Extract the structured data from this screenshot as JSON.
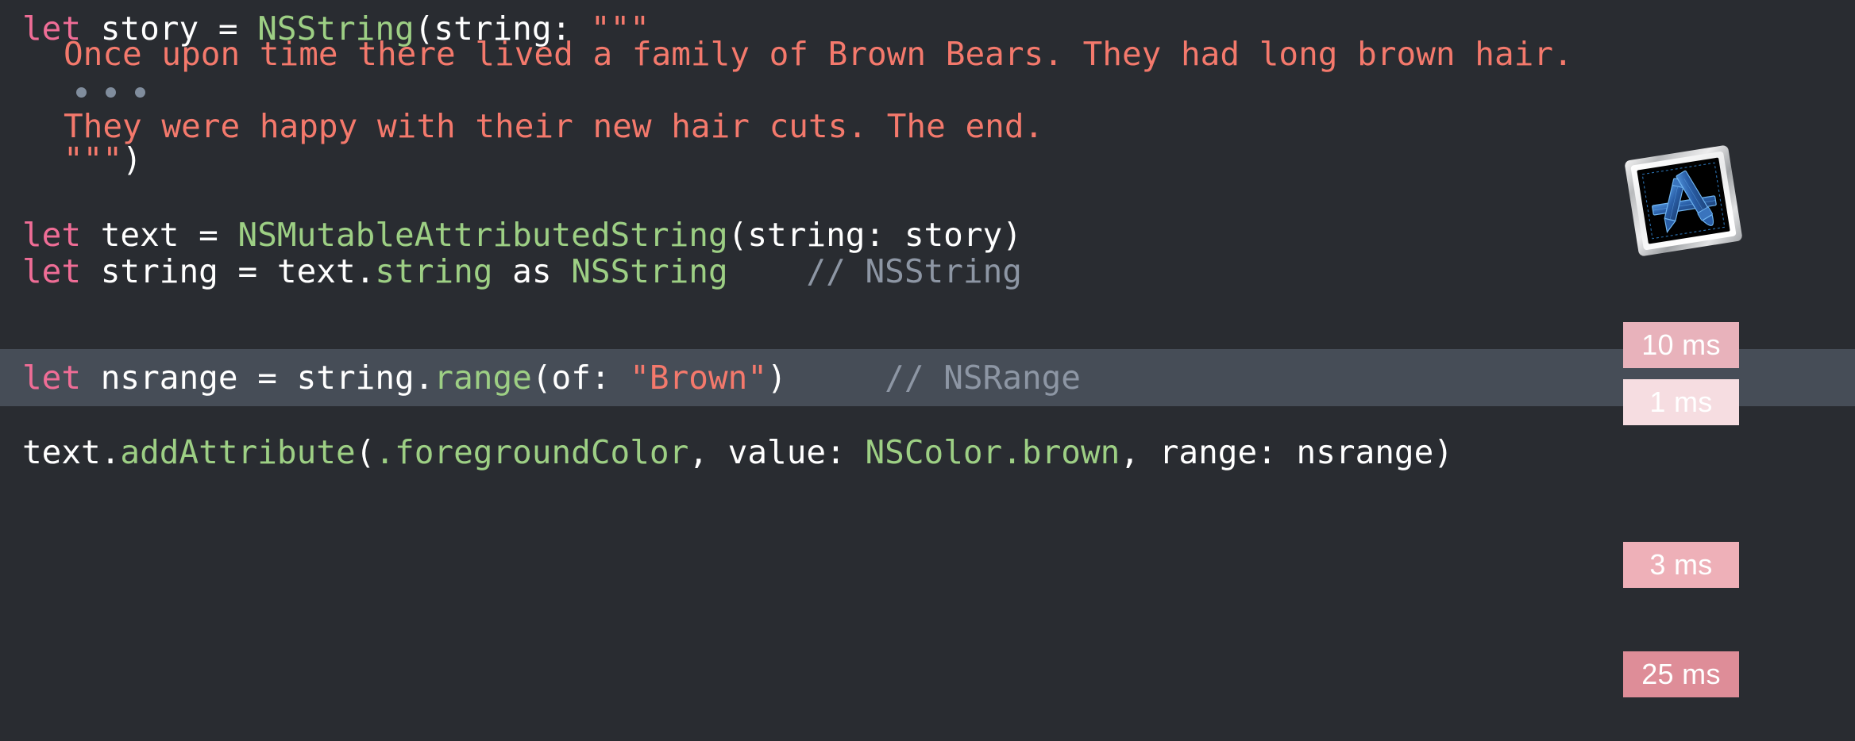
{
  "editor": {
    "background_color": "#292c31",
    "highlight_color": "#464d57",
    "colors": {
      "keyword": "#ef6d96",
      "plain": "#ffffff",
      "type": "#9dcf84",
      "string": "#f4796c",
      "comment": "#8d96a4",
      "fold_dot": "#808d9d"
    }
  },
  "code": {
    "line1": {
      "kw_let": "let",
      "name": " story ",
      "eq": "= ",
      "type": "NSString",
      "paren": "(",
      "label": "string: ",
      "quotes": "\"\"\""
    },
    "line2": {
      "text": "Once upon time there lived a family of Brown Bears. They had long brown hair."
    },
    "line3_fold": "…",
    "line4": {
      "text": "They were happy with their new hair cuts. The end."
    },
    "line5": {
      "quotes": "\"\"\"",
      "close": ")"
    },
    "line6": {
      "kw_let": "let",
      "name": " text ",
      "eq": "= ",
      "type": "NSMutableAttributedString",
      "rest": "(string: story)"
    },
    "line7": {
      "kw_let": "let",
      "name": " string ",
      "eq": "= ",
      "obj": "text.",
      "prop": "string",
      "as": " as ",
      "type": "NSString",
      "comment": "    // NSString"
    },
    "line8": {
      "kw_let": "let",
      "name": " nsrange ",
      "eq": "= ",
      "obj": "string.",
      "method": "range",
      "args_open": "(of: ",
      "literal": "\"Brown\"",
      "args_close": ")",
      "comment": "     // NSRange"
    },
    "line9": {
      "obj": "text.",
      "method": "addAttribute",
      "paren": "(",
      "key": ".foregroundColor",
      "sep1": ", value: ",
      "value": "NSColor.brown",
      "sep2": ", range: nsrange)"
    }
  },
  "results": {
    "badges": [
      {
        "label": "10 ms",
        "color": "#e8b2bb"
      },
      {
        "label": "1 ms",
        "color": "#f6dde1"
      },
      {
        "label": "3 ms",
        "color": "#eeb0b8"
      },
      {
        "label": "25 ms",
        "color": "#de8d98"
      }
    ]
  },
  "icons": {
    "xcode_app_icon": "xcode-icon"
  }
}
